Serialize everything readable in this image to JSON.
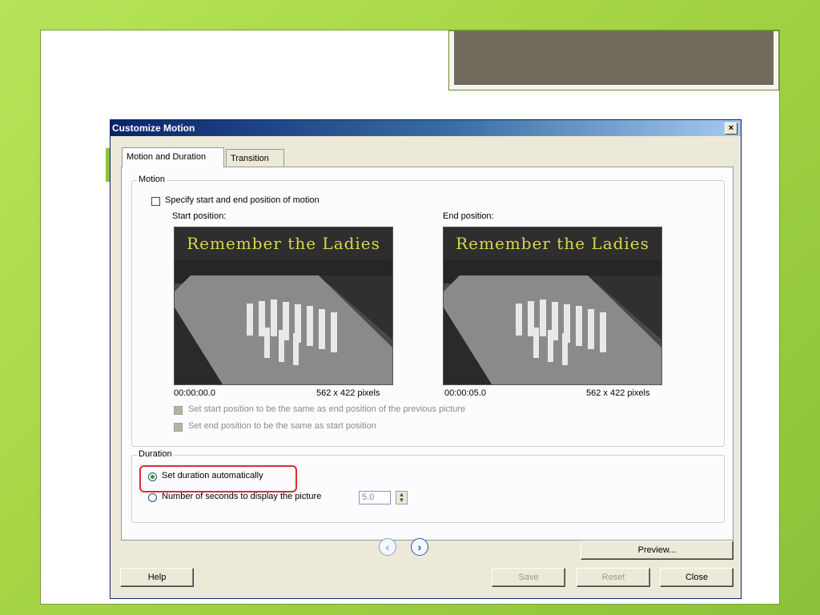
{
  "dialog": {
    "title": "Customize Motion",
    "close_glyph": "×"
  },
  "tabs": [
    {
      "label": "Motion and Duration",
      "active": true
    },
    {
      "label": "Transition",
      "active": false
    }
  ],
  "motion": {
    "group_label": "Motion",
    "specify_checkbox_label": "Specify start and end position of motion",
    "start_label": "Start position:",
    "end_label": "End position:",
    "start_time": "00:00:00.0",
    "end_time": "00:00:05.0",
    "start_size": "562 x 422 pixels",
    "end_size": "562 x 422 pixels",
    "image_caption": "Remember the Ladies",
    "same_as_previous_label": "Set start position to be the same as end position of the previous picture",
    "same_as_start_label": "Set end position to be the same as start position"
  },
  "duration": {
    "group_label": "Duration",
    "auto_label": "Set duration automatically",
    "seconds_label": "Number of seconds to display the picture",
    "seconds_value": "5.0"
  },
  "nav": {
    "prev_glyph": "‹",
    "next_glyph": "›"
  },
  "buttons": {
    "help": "Help",
    "save": "Save",
    "reset": "Reset",
    "close": "Close",
    "preview": "Preview..."
  },
  "colors": {
    "background": "#a6d646",
    "title_bar": "#0a246a",
    "highlight": "#d93030",
    "banner": "#736a5e"
  }
}
